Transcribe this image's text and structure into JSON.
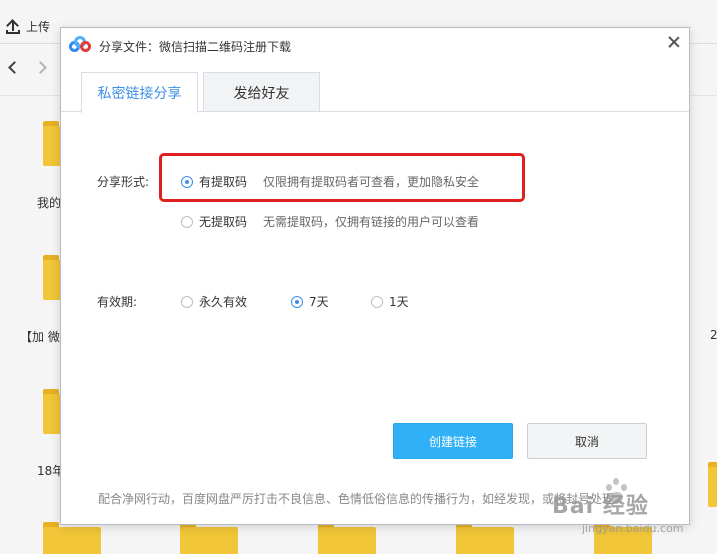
{
  "app": {
    "upload_label": "上传",
    "folder_labels": [
      "我的",
      "【加 微",
      "18年"
    ],
    "right_edge_label": "2"
  },
  "dialog": {
    "title": "分享文件：微信扫描二维码注册下载",
    "tabs": [
      {
        "label": "私密链接分享",
        "active": true
      },
      {
        "label": "发给好友",
        "active": false
      }
    ],
    "share_form": {
      "label": "分享形式:",
      "options": [
        {
          "label": "有提取码",
          "desc": "仅限拥有提取码者可查看，更加隐私安全",
          "selected": true
        },
        {
          "label": "无提取码",
          "desc": "无需提取码，仅拥有链接的用户可以查看",
          "selected": false
        }
      ]
    },
    "validity": {
      "label": "有效期:",
      "options": [
        {
          "label": "永久有效",
          "selected": false
        },
        {
          "label": "7天",
          "selected": true
        },
        {
          "label": "1天",
          "selected": false
        }
      ]
    },
    "create_button": "创建链接",
    "cancel_button": "取消",
    "notice": "配合净网行动，百度网盘严厉打击不良信息、色情低俗信息的传播行为，如经发现，或将封号处理。"
  },
  "watermark": {
    "main": "Bai 经验",
    "sub": "jingyan.baidu.com"
  },
  "colors": {
    "accent": "#3d8fe8",
    "primary_button": "#2fb0f7",
    "highlight_box": "#e02020",
    "folder": "#fbcf3b"
  }
}
